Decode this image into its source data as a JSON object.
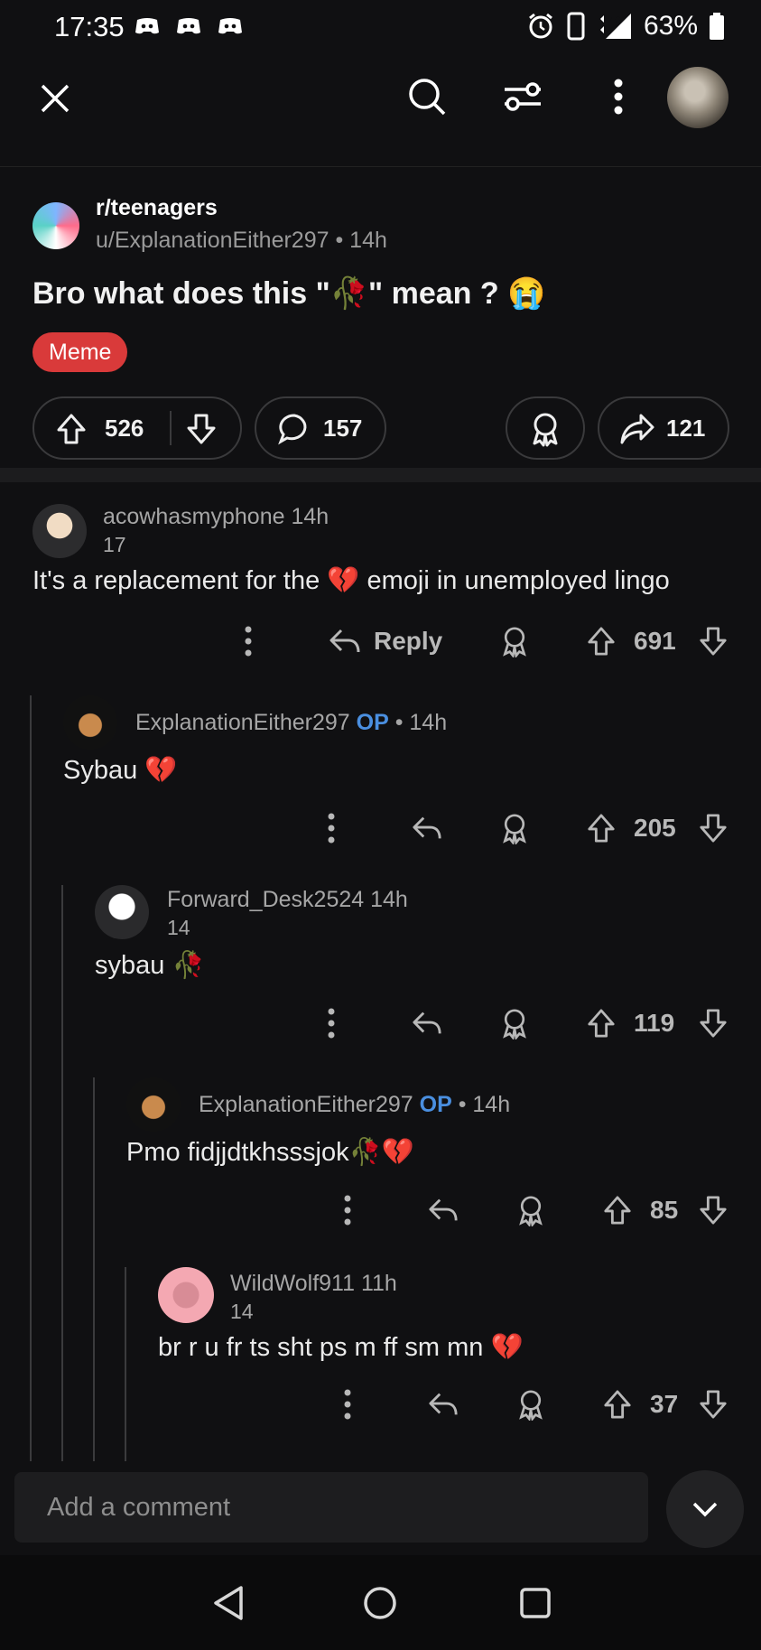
{
  "status_bar": {
    "time": "17:35",
    "battery": "63%",
    "network": "4G"
  },
  "topbar": {
    "close": "close-icon",
    "search": "search-icon",
    "filter": "filter-icon",
    "more": "more-icon"
  },
  "post": {
    "subreddit": "r/teenagers",
    "author": "u/ExplanationEither297",
    "age": "• 14h",
    "title": "Bro what does this \"🥀\" mean ? 😭",
    "flair": "Meme",
    "upvotes": "526",
    "comments": "157",
    "shares": "121"
  },
  "comments": [
    {
      "user": "acowhasmyphone",
      "op": "",
      "time": "14h",
      "flair": "17",
      "text": "It's a replacement for the 💔 emoji in unemployed lingo",
      "reply_label": "Reply",
      "votes": "691"
    },
    {
      "user": "ExplanationEither297",
      "op": "OP",
      "time": "• 14h",
      "flair": "",
      "text": "Sybau 💔",
      "votes": "205"
    },
    {
      "user": "Forward_Desk2524",
      "op": "",
      "time": "14h",
      "flair": "14",
      "text": "sybau 🥀",
      "votes": "119"
    },
    {
      "user": "ExplanationEither297",
      "op": "OP",
      "time": "• 14h",
      "flair": "",
      "text": "Pmo fidjjdtkhsssjok🥀💔",
      "votes": "85"
    },
    {
      "user": "WildWolf911",
      "op": "",
      "time": "11h",
      "flair": "14",
      "text": "br r u fr ts sht ps m ff sm mn 💔",
      "votes": "37"
    }
  ],
  "composer": {
    "placeholder": "Add a comment"
  },
  "colors": {
    "background": "#101012",
    "flair": "#d93a3a",
    "op": "#4a8fe0"
  }
}
